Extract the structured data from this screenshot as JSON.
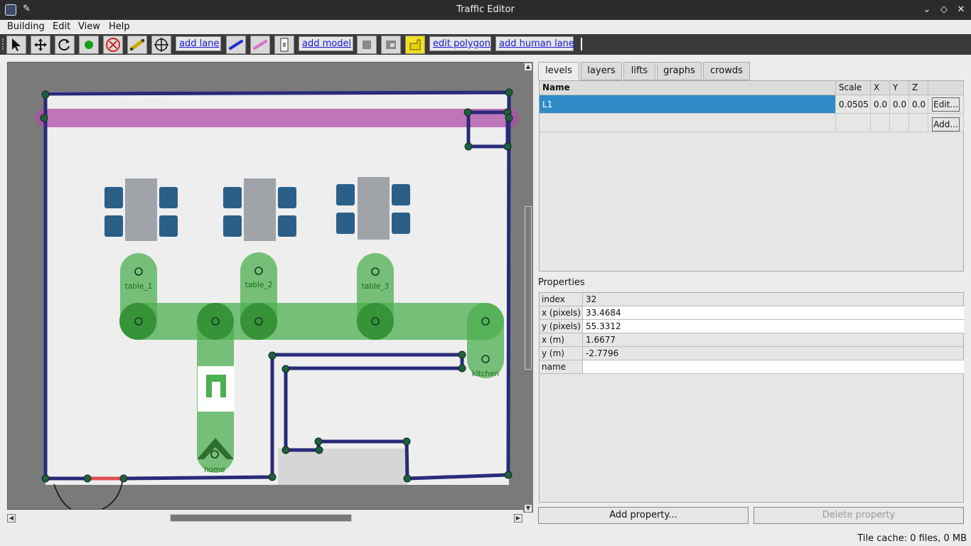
{
  "window": {
    "title": "Traffic Editor"
  },
  "menu": [
    "Building",
    "Edit",
    "View",
    "Help"
  ],
  "toolbar": {
    "add_lane": "add lane",
    "add_model": "add model",
    "edit_polygon": "edit polygon",
    "add_human_lane": "add human lane"
  },
  "map": {
    "labels": {
      "table_1": "table_1",
      "table_2": "table_2",
      "table_3": "table_3",
      "kitchen": "kitchen",
      "home": "home"
    },
    "colors": {
      "wall": "#2a2a7a",
      "floor": "#eeeeee",
      "lane": "#4caf50",
      "vertex": "#1f5f3f",
      "human_lane": "#b04ca8",
      "door": "#e05050"
    }
  },
  "tabs": [
    "levels",
    "layers",
    "lifts",
    "graphs",
    "crowds"
  ],
  "levels": {
    "headers": {
      "name": "Name",
      "scale": "Scale",
      "x": "X",
      "y": "Y",
      "z": "Z"
    },
    "rows": [
      {
        "name": "L1",
        "scale": "0.0505",
        "x": "0.0",
        "y": "0.0",
        "z": "0.0",
        "button": "Edit..."
      }
    ],
    "add_button": "Add..."
  },
  "properties": {
    "title": "Properties",
    "rows": [
      {
        "key": "index",
        "value": "32"
      },
      {
        "key": "x (pixels)",
        "value": "33.4684"
      },
      {
        "key": "y (pixels)",
        "value": "55.3312"
      },
      {
        "key": "x (m)",
        "value": "1.6677"
      },
      {
        "key": "y (m)",
        "value": "-2.7796"
      },
      {
        "key": "name",
        "value": ""
      }
    ],
    "add_button": "Add property...",
    "delete_button": "Delete property"
  },
  "status": {
    "text": "Tile cache: 0 files, 0 MB"
  }
}
